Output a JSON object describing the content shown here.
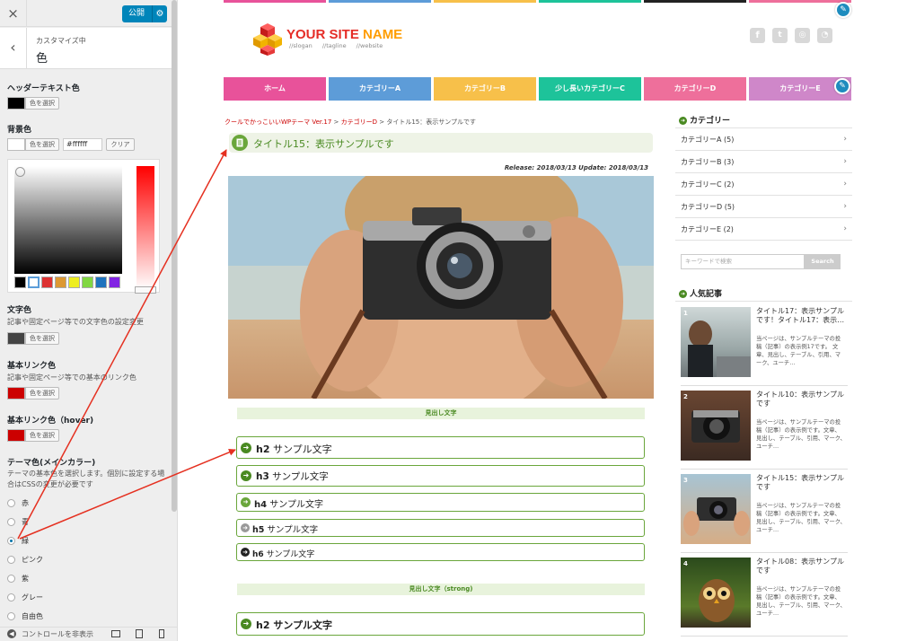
{
  "customizer": {
    "close_icon": "×",
    "publish_label": "公開",
    "back_icon": "‹",
    "breadcrumb_label": "カスタマイズ中",
    "section_title": "色",
    "header_text_color": {
      "label": "ヘッダーテキスト色",
      "button": "色を選択",
      "swatch": "#000000"
    },
    "background_color": {
      "label": "背景色",
      "button": "色を選択",
      "hex_value": "#ffffff",
      "clear": "クリア",
      "swatch": "#ffffff"
    },
    "palette": [
      "#000000",
      "#ffffff",
      "#dd3333",
      "#dd9933",
      "#eeee22",
      "#81d742",
      "#1e73be",
      "#8224e3"
    ],
    "text_color": {
      "label": "文字色",
      "description": "記事や固定ページ等での文字色の設定変更",
      "button": "色を選択",
      "swatch": "#444444"
    },
    "link_color": {
      "label": "基本リンク色",
      "description": "記事や固定ページ等での基本のリンク色",
      "button": "色を選択",
      "swatch": "#cc0000"
    },
    "link_hover_color": {
      "label": "基本リンク色（hover)",
      "button": "色を選択",
      "swatch": "#cc0000"
    },
    "theme_color": {
      "label": "テーマ色(メインカラー)",
      "description": "テーマの基本色を選択します。個別に設定する場合はCSSの変更が必要です",
      "options": [
        "赤",
        "青",
        "緑",
        "ピンク",
        "紫",
        "グレー",
        "自由色"
      ],
      "selected": "緑"
    },
    "footer": {
      "hide_controls": "コントロールを非表示"
    }
  },
  "site": {
    "top_strip_colors": [
      "#e8529a",
      "#5d9cd8",
      "#f7c04a",
      "#1dc39a",
      "#222222",
      "#ee6f9b",
      "#cf87c9"
    ],
    "logo": {
      "name_a": "YOUR SITE",
      "name_b": " NAME",
      "slogans": "//slogan //tagline //website"
    },
    "social_icons": [
      "facebook-icon",
      "twitter-icon",
      "instagram-icon",
      "rss-icon"
    ],
    "nav": [
      {
        "label": "ホーム",
        "color": "#e8529a"
      },
      {
        "label": "カテゴリーA",
        "color": "#5d9cd8"
      },
      {
        "label": "カテゴリーB",
        "color": "#f7c04a"
      },
      {
        "label": "少し長いカテゴリーC",
        "color": "#1dc39a"
      },
      {
        "label": "カテゴリーD",
        "color": "#ee6f9b"
      },
      {
        "label": "カテゴリーE",
        "color": "#cf87c9"
      }
    ],
    "breadcrumb": {
      "home": "クールでかっこいいWPテーマ Ver.17",
      "sep": " > ",
      "category": "カテゴリーD",
      "current": "タイトル15：表示サンプルです"
    },
    "post_title": "タイトル15：表示サンプルです",
    "release": "Release: 2018/03/13 Update: 2018/03/13",
    "section1": "見出し文字",
    "headings": [
      {
        "tag": "h2",
        "text": "サンプル文字"
      },
      {
        "tag": "h3",
        "text": "サンプル文字"
      },
      {
        "tag": "h4",
        "text": "サンプル文字"
      },
      {
        "tag": "h5",
        "text": "サンプル文字"
      },
      {
        "tag": "h6",
        "text": "サンプル文字"
      }
    ],
    "section2": "見出し文字（strong)",
    "heading_strong": {
      "tag": "h2",
      "text": "サンプル文字"
    },
    "sidebar": {
      "categories_title": "カテゴリー",
      "categories": [
        "カテゴリーA (5)",
        "カテゴリーB (3)",
        "カテゴリーC (2)",
        "カテゴリーD (5)",
        "カテゴリーE (2)"
      ],
      "search_placeholder": "キーワードで検索",
      "search_button": "Search",
      "popular_title": "人気記事",
      "popular": [
        {
          "rank": "1",
          "title": "タイトル17：表示サンプルです！タイトル17：表示…",
          "excerpt": "当ページは、サンプルテーマの投稿（記事）の表示例17です。 文章、見出し、テーブル、引用、マーク、ユーチ…"
        },
        {
          "rank": "2",
          "title": "タイトル10：表示サンプルです",
          "excerpt": "当ページは、サンプルテーマの投稿（記事）の表示例です。文章、見出し、テーブル、引用、マーク、ユーチ…"
        },
        {
          "rank": "3",
          "title": "タイトル15：表示サンプルです",
          "excerpt": "当ページは、サンプルテーマの投稿（記事）の表示例です。文章、見出し、テーブル、引用、マーク、ユーチ…"
        },
        {
          "rank": "4",
          "title": "タイトル08：表示サンプルです",
          "excerpt": "当ページは、サンプルテーマの投稿（記事）の表示例です。文章、見出し、テーブル、引用、マーク、ユーチ…"
        }
      ]
    }
  }
}
